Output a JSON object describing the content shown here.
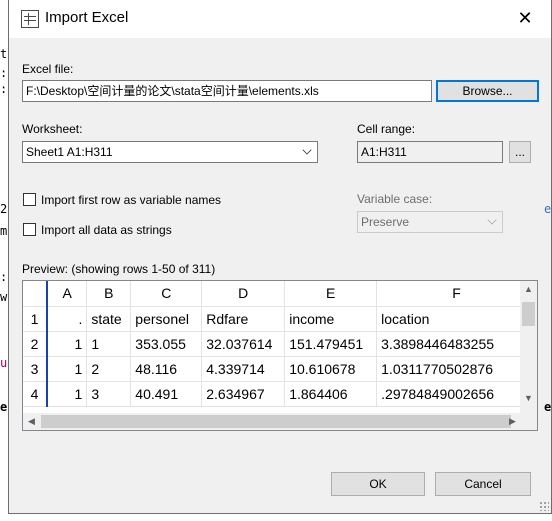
{
  "dialog": {
    "title": "Import Excel",
    "close": "✕"
  },
  "excel_file": {
    "label": "Excel file:",
    "value": "F:\\Desktop\\空间计量的论文\\stata空间计量\\elements.xls",
    "browse": "Browse..."
  },
  "worksheet": {
    "label": "Worksheet:",
    "value": "Sheet1 A1:H311"
  },
  "cell_range": {
    "label": "Cell range:",
    "value": "A1:H311",
    "button": "..."
  },
  "options": {
    "first_row": "Import first row as variable names",
    "all_strings": "Import all data as strings"
  },
  "variable_case": {
    "label": "Variable case:",
    "value": "Preserve"
  },
  "preview": {
    "label": "Preview: (showing rows 1-50 of 311)",
    "columns": [
      "A",
      "B",
      "C",
      "D",
      "E",
      "F"
    ],
    "rows": [
      {
        "num": "1",
        "cells": [
          ".",
          "state",
          "personel",
          "Rdfare",
          "income",
          "location"
        ]
      },
      {
        "num": "2",
        "cells": [
          "1",
          "1",
          "353.055",
          "32.037614",
          "151.479451",
          "3.3898446483255"
        ]
      },
      {
        "num": "3",
        "cells": [
          "1",
          "2",
          "48.116",
          "4.339714",
          "10.610678",
          "1.0311770502876"
        ]
      },
      {
        "num": "4",
        "cells": [
          "1",
          "3",
          "40.491",
          "2.634967",
          "1.864406",
          ".29784849002656"
        ]
      }
    ]
  },
  "footer": {
    "ok": "OK",
    "cancel": "Cancel"
  },
  "background": {
    "left_chars": [
      "t",
      ":",
      ":",
      "2",
      "m",
      ":",
      "w",
      "u",
      "e"
    ],
    "right_chars": [
      "e",
      "e"
    ]
  }
}
